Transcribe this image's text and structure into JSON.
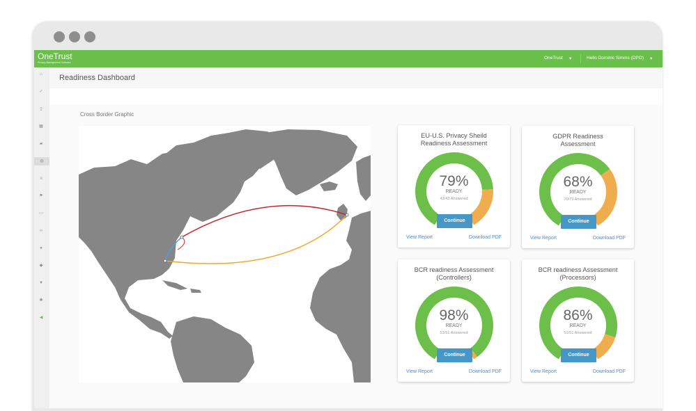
{
  "app": {
    "name": "OneTrust",
    "subtitle": "Privacy Management Software"
  },
  "topbar": {
    "account_menu": "OneTrust",
    "user_menu": "Hello Dominic Simms (DPO)"
  },
  "page": {
    "title": "Readiness Dashboard",
    "section_title": "Cross Border Graphic"
  },
  "sidebar": {
    "icons": [
      "home-icon",
      "check-icon",
      "document-icon",
      "grid-icon",
      "car-icon",
      "globe-icon",
      "list-icon",
      "flag-icon",
      "folder-icon",
      "code-icon",
      "user-icon",
      "group-icon",
      "filter-icon",
      "gear-icon",
      "megaphone-icon"
    ]
  },
  "colors": {
    "brand_green": "#6abf4b",
    "ready_green": "#6cc04a",
    "remaining_orange": "#f0ad4e",
    "button_blue": "#4497c7",
    "arc_red": "#c0262d",
    "arc_orange": "#f4a62a",
    "arc_blue": "#4da3d8"
  },
  "assessments": [
    {
      "title_line1": "EU-U.S. Privacy Sheild",
      "title_line2": "Readiness Assessment",
      "percent_label": "79%",
      "percent": 79,
      "ready_label": "READY",
      "answered": "43/43 Answered",
      "button": "Continue",
      "view_report": "View Report",
      "download_pdf": "Download PDF"
    },
    {
      "title_line1": "GDPR Readiness",
      "title_line2": "Assessment",
      "percent_label": "68%",
      "percent": 68,
      "ready_label": "READY",
      "answered": "70/73 Answered",
      "button": "Continue",
      "view_report": "View Report",
      "download_pdf": "Download PDF"
    },
    {
      "title_line1": "BCR readiness Assessment",
      "title_line2": "(Controllers)",
      "percent_label": "98%",
      "percent": 98,
      "ready_label": "READY",
      "answered": "51/51 Answered",
      "button": "Continue",
      "view_report": "View Report",
      "download_pdf": "Download PDF"
    },
    {
      "title_line1": "BCR readiness Assessment",
      "title_line2": "(Processors)",
      "percent_label": "86%",
      "percent": 86,
      "ready_label": "READY",
      "answered": "51/51 Answered",
      "button": "Continue",
      "view_report": "View Report",
      "download_pdf": "Download PDF"
    }
  ]
}
